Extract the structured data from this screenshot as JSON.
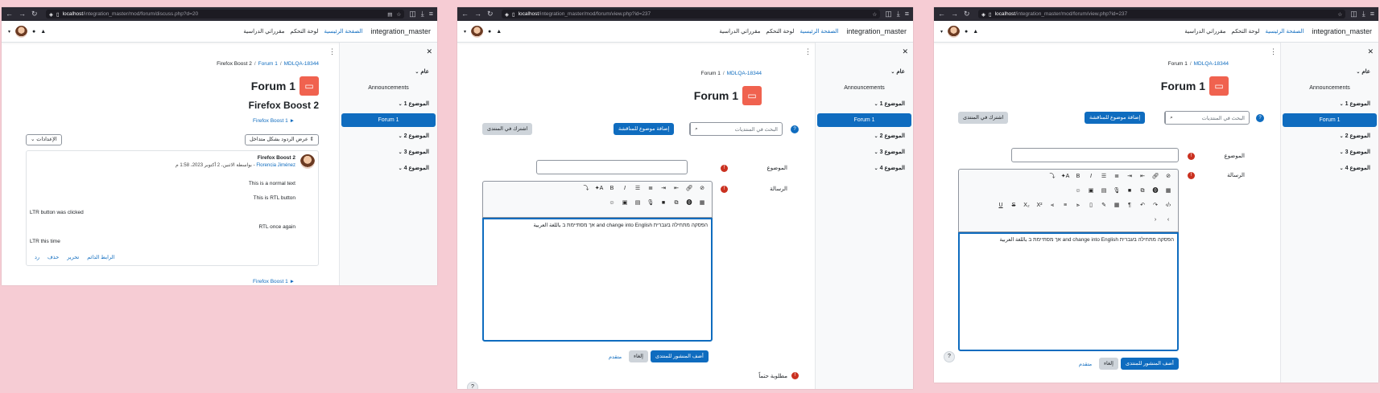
{
  "browser": {
    "url_host": "localhost",
    "w1_path": "/integration_master/mod/forum/discuss.php?d=20",
    "w2_path": "/integration_master/mod/forum/view.php?id=237",
    "w3_path": "/integration_master/mod/forum/view.php?id=237"
  },
  "navbar": {
    "brand": "integration_master",
    "home": "الصفحة الرئيسية",
    "dashboard": "لوحة التحكم",
    "my_courses": "مقرراتي الدراسية"
  },
  "drawer": {
    "general": "عام",
    "announcements": "Announcements",
    "topic1": "الموضوع 1",
    "forum1": "Forum 1",
    "topic2": "الموضوع 2",
    "topic3": "الموضوع 3",
    "topic4": "الموضوع 4"
  },
  "discussion": {
    "breadcrumb": [
      "Firefox Boost 2",
      "Forum 1",
      "MDLQA-18344"
    ],
    "title": "Forum 1",
    "subtitle": "Firefox Boost 2",
    "prev_link": "Firefox Boost 1 ►",
    "display_mode": "عرض الردود بشكل متداخل",
    "settings": "الإعدادات",
    "post": {
      "author_title": "Firefox Boost 2",
      "meta_prefix": "بواسطة الاثنين، 2 أكتوبر 2023، 1:58 م - ",
      "meta_author": "Florencia Jiménez",
      "lines": [
        "This is a normal text",
        "This is RTL button",
        "LTR button was clicked",
        "RTL once again",
        "LTR this time"
      ],
      "actions": [
        "الرابط الدائم",
        "تحرير",
        "حذف",
        "رد"
      ]
    },
    "next_link": "Firefox Boost 1 ►"
  },
  "forum_view": {
    "breadcrumb": [
      "Forum 1",
      "MDLQA-18344"
    ],
    "title": "Forum 1",
    "search_placeholder": "البحث في المنتديات",
    "add_topic": "إضافة موضوع للمناقشة",
    "subscribe": "اشترك في المنتدى",
    "subject_label": "الموضوع",
    "message_label": "الرسالة",
    "editor_text": "אך מסתיימת ב باللغة العربية and change into English הפסקה מתחילה בעברית",
    "post_button": "أضف المنشور للمنتدى",
    "cancel_button": "إلغاء",
    "advanced_link": "متقدم",
    "required_note": "مطلوبة حتماً",
    "help_mark": "?"
  }
}
